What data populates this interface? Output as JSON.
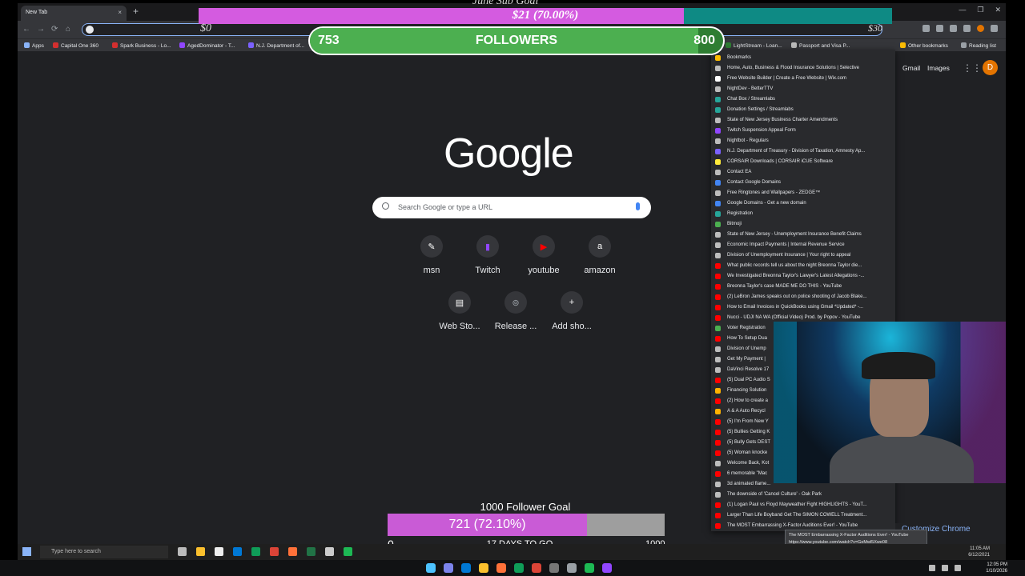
{
  "browser": {
    "tab_title": "New Tab",
    "newtab_symbol": "+",
    "close_symbol": "×",
    "window_controls": [
      "—",
      "❐",
      "✕"
    ],
    "nav": [
      "←",
      "→",
      "⟳",
      "⌂"
    ]
  },
  "bookmarks_bar": [
    {
      "label": "Apps",
      "color": "#4285f4"
    },
    {
      "label": "Capital One 360",
      "color": "#d32f2f"
    },
    {
      "label": "Spark Business - Lo...",
      "color": "#d32f2f"
    },
    {
      "label": "AgedDominator - T...",
      "color": "#9146ff"
    },
    {
      "label": "N.J. Department of...",
      "color": "#7b61ff"
    },
    {
      "label": "LightStream - Loan...",
      "color": "#2e7d32"
    },
    {
      "label": "Passport and Visa P...",
      "color": "#bdbdbd"
    },
    {
      "label": "Other bookmarks",
      "color": "#fbbc04"
    },
    {
      "label": "Reading list",
      "color": "#9aa0a6"
    }
  ],
  "google_page": {
    "logo": "Google",
    "gmail": "Gmail",
    "images": "Images",
    "apps_glyph": "⋮⋮⋮",
    "profile_initial": "D",
    "search_placeholder": "Search Google or type a URL",
    "shortcuts": [
      {
        "label": "msn",
        "glyph": "✎",
        "color": "#ffffff"
      },
      {
        "label": "Twitch",
        "glyph": "▮",
        "color": "#9146ff"
      },
      {
        "label": "youtube",
        "glyph": "▶",
        "color": "#ff0000"
      },
      {
        "label": "amazon",
        "glyph": "a",
        "color": "#ffffff"
      },
      {
        "label": "Web Sto...",
        "glyph": "▤",
        "color": "#ffffff"
      },
      {
        "label": "Release ...",
        "glyph": "⊚",
        "color": "#9aa0a6"
      },
      {
        "label": "Add sho...",
        "glyph": "+",
        "color": "#e8eaed"
      }
    ],
    "customize": "Customize Chrome"
  },
  "bookmarks_menu": {
    "items": [
      {
        "label": "Bookmarks",
        "color": "#fbbc04"
      },
      {
        "label": "Home, Auto, Business & Flood Insurance Solutions | Selective",
        "color": "#bdbdbd"
      },
      {
        "label": "Free Website Builder | Create a Free Website | Wix.com",
        "color": "#ffffff"
      },
      {
        "label": "NightDev - BetterTTV",
        "color": "#bdbdbd"
      },
      {
        "label": "Chat Box / Streamlabs",
        "color": "#26a69a"
      },
      {
        "label": "Donation Settings / Streamlabs",
        "color": "#26a69a"
      },
      {
        "label": "State of New Jersey Business Charter Amendments",
        "color": "#bdbdbd"
      },
      {
        "label": "Twitch Suspension Appeal Form",
        "color": "#9146ff"
      },
      {
        "label": "Nightbot - Regulars",
        "color": "#bdbdbd"
      },
      {
        "label": "N.J. Department of Treasury - Division of Taxation, Amnesty Ap...",
        "color": "#7b61ff"
      },
      {
        "label": "CORSAIR Downloads | CORSAIR iCUE Software",
        "color": "#ffeb3b"
      },
      {
        "label": "Contact EA",
        "color": "#bdbdbd"
      },
      {
        "label": "Contact Google Domains",
        "color": "#4285f4"
      },
      {
        "label": "Free Ringtones and Wallpapers - ZEDGE™",
        "color": "#bdbdbd"
      },
      {
        "label": "Google Domains - Get a new domain",
        "color": "#4285f4"
      },
      {
        "label": "Registration",
        "color": "#26a69a"
      },
      {
        "label": "Bitmoji",
        "color": "#4caf50"
      },
      {
        "label": "State of New Jersey - Unemployment Insurance Benefit Claims",
        "color": "#bdbdbd"
      },
      {
        "label": "Economic Impact Payments | Internal Revenue Service",
        "color": "#bdbdbd"
      },
      {
        "label": "Division of Unemployment Insurance | Your right to appeal",
        "color": "#bdbdbd"
      },
      {
        "label": "What public records tell us about the night Breonna Taylor die...",
        "color": "#ff0000"
      },
      {
        "label": "We Investigated Breonna Taylor's Lawyer's Latest Allegations -...",
        "color": "#ff0000"
      },
      {
        "label": "Breonna Taylor's case MADE ME DO THIS - YouTube",
        "color": "#ff0000"
      },
      {
        "label": "(2) LeBron James speaks out on police shooting of Jacob Blake...",
        "color": "#ff0000"
      },
      {
        "label": "How to Email Invoices in QuickBooks using Gmail *Updated* -...",
        "color": "#ff0000"
      },
      {
        "label": "Nucci - UDJI NA WA (Official Video) Prod. by Popov - YouTube",
        "color": "#ff0000"
      },
      {
        "label": "Voter Registration",
        "color": "#4caf50"
      },
      {
        "label": "How To Setup Dua",
        "color": "#ff0000"
      },
      {
        "label": "Division of Unemp",
        "color": "#bdbdbd"
      },
      {
        "label": "Get My Payment |",
        "color": "#bdbdbd"
      },
      {
        "label": "DaVinci Resolve 17",
        "color": "#bdbdbd"
      },
      {
        "label": "(5) Dual PC Audio S",
        "color": "#ff0000"
      },
      {
        "label": "Financing Solution",
        "color": "#ffb300"
      },
      {
        "label": "(2) How to create a",
        "color": "#ff0000"
      },
      {
        "label": "A & A Auto Recycl",
        "color": "#ffb300"
      },
      {
        "label": "(5) I'm From New Y",
        "color": "#ff0000"
      },
      {
        "label": "(5) Bullies Getting K",
        "color": "#ff0000"
      },
      {
        "label": "(5) Bully Gets DEST",
        "color": "#ff0000"
      },
      {
        "label": "(5) Woman knocke",
        "color": "#ff0000"
      },
      {
        "label": "Welcome Back, Kot",
        "color": "#bdbdbd"
      },
      {
        "label": "6 memorable \"Mac",
        "color": "#ff0000"
      },
      {
        "label": "3d animated flame...",
        "color": "#bdbdbd"
      },
      {
        "label": "The downside of 'Cancel Culture' - Oak Park",
        "color": "#bdbdbd"
      },
      {
        "label": "(1) Logan Paul vs Floyd Mayweather Fight HIGHLIGHTS - YouT...",
        "color": "#ff0000"
      },
      {
        "label": "Larger Than Life Boyband Get The SIMON COWELL Treatment...",
        "color": "#ff0000"
      },
      {
        "label": "The MOST Embarrassing X-Factor Auditions Ever! - YouTube",
        "color": "#ff0000"
      }
    ],
    "tooltip_title": "The MOST Embarrassing X-Factor Auditions Ever! - YouTube",
    "tooltip_url": "https://www.youtube.com/watch?v=GeMwl5Xwe08"
  },
  "overlays": {
    "sub_goal": {
      "title": "June Sub Goal",
      "text": "$21 (70.00%)",
      "progress_percent": 70,
      "min": "$0",
      "max": "$30",
      "fill_color": "#d45be0",
      "track_color": "#0e8a84"
    },
    "followers": {
      "label": "FOLLOWERS",
      "current": "753",
      "target": "800",
      "progress_percent": 94
    },
    "follower_goal": {
      "title": "1000 Follower Goal",
      "text": "721 (72.10%)",
      "progress_percent": 72.1,
      "min": "0",
      "max": "1000",
      "days": "17 DAYS TO GO"
    }
  },
  "inner_taskbar": {
    "search_placeholder": "Type here to search",
    "time": "11:05 AM",
    "date": "6/12/2021"
  },
  "outer_taskbar": {
    "time": "12:05 PM",
    "date": "1/10/2026"
  }
}
